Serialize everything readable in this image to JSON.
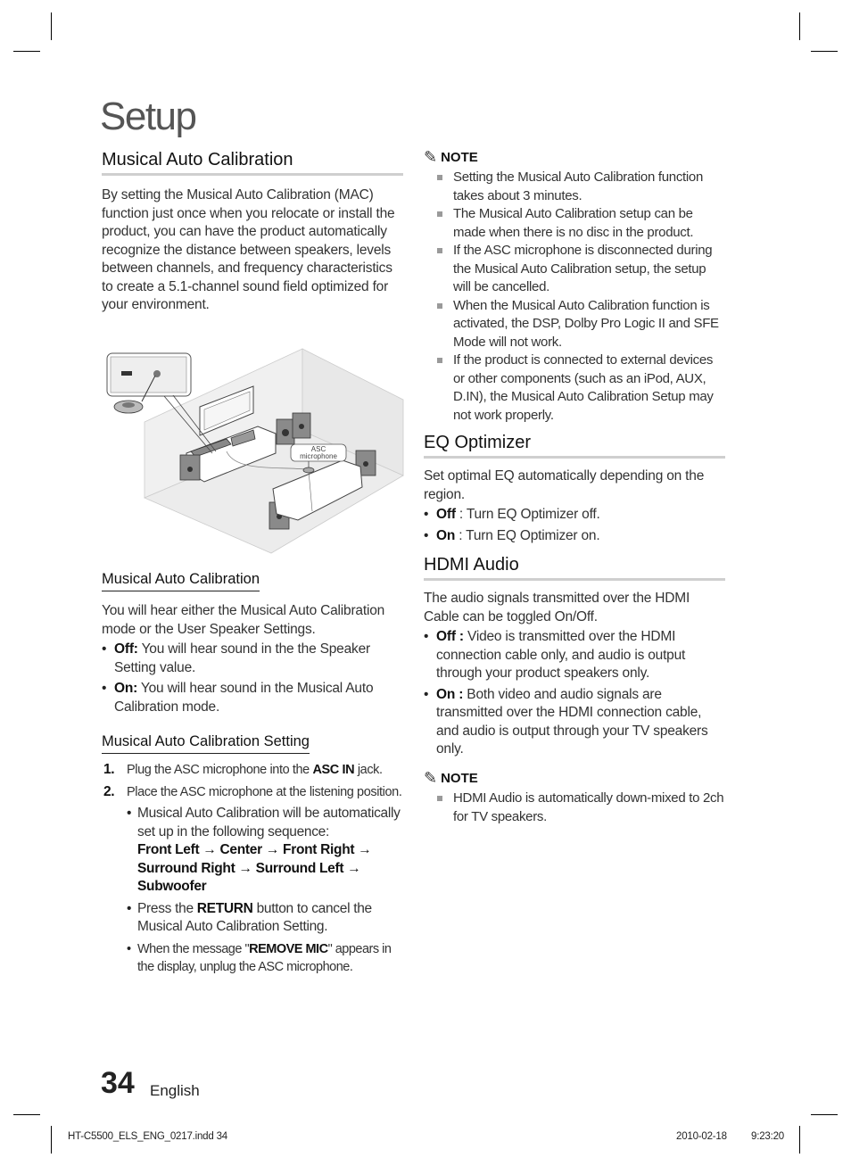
{
  "page": {
    "title": "Setup",
    "page_number": "34",
    "language": "English",
    "slug_file": "HT-C5500_ELS_ENG_0217.indd   34",
    "slug_date": "2010-02-18",
    "slug_time": "9:23:20"
  },
  "left": {
    "mac_heading": "Musical Auto Calibration",
    "mac_intro": "By setting the Musical Auto Calibration (MAC) function just once when you relocate or install the product, you can have the product automatically recognize the distance between speakers, levels between channels, and frequency characteristics to create a 5.1-channel sound field optimized for your environment.",
    "diagram": {
      "mic_label_line1": "ASC",
      "mic_label_line2": "microphone"
    },
    "mode_heading": "Musical Auto Calibration",
    "mode_intro": "You will hear either the Musical Auto Calibration mode or the User Speaker Settings.",
    "mode_items": [
      {
        "label": "Off:",
        "text": " You will hear sound in the the Speaker Setting value."
      },
      {
        "label": "On:",
        "text": " You will hear sound in the Musical Auto Calibration mode."
      }
    ],
    "setting_heading": "Musical Auto Calibration Setting",
    "steps": [
      {
        "num": "1.",
        "pre": "Plug the ASC microphone into the ",
        "bold": "ASC IN",
        "post": " jack."
      },
      {
        "num": "2.",
        "pre": "Place the ASC microphone at the listening position.",
        "bold": "",
        "post": ""
      }
    ],
    "step2_bullets": {
      "seq_intro": "Musical Auto Calibration will be automatically set up in the following sequence:",
      "sequence": "Front Left → Center → Front Right → Surround Right → Surround Left → Subwoofer",
      "return_pre": "Press the ",
      "return_bold": "RETURN",
      "return_post": " button to cancel the Musical Auto Calibration Setting.",
      "remove_pre": "When the message \"",
      "remove_bold": "REMOVE MIC",
      "remove_post": "\" appears in the display, unplug the ASC microphone."
    }
  },
  "right": {
    "note1": {
      "label": "NOTE",
      "icon": "pencil-icon",
      "items": [
        "Setting the Musical Auto Calibration function takes about 3 minutes.",
        "The Musical Auto Calibration setup can be made when there is no disc in the product.",
        "If the ASC microphone is disconnected during the Musical Auto Calibration setup, the setup will be cancelled.",
        "When the Musical Auto Calibration function is activated, the DSP, Dolby Pro Logic II and SFE Mode will not work.",
        "If the product is connected to external devices or other components (such as an iPod, AUX, D.IN), the Musical Auto Calibration Setup may not work properly."
      ]
    },
    "eq": {
      "heading": "EQ Optimizer",
      "intro": "Set optimal EQ automatically depending on the region.",
      "items": [
        {
          "label": "Off",
          "text": " : Turn EQ Optimizer off."
        },
        {
          "label": "On",
          "text": " : Turn EQ Optimizer on."
        }
      ]
    },
    "hdmi": {
      "heading": "HDMI Audio",
      "intro": "The audio signals transmitted over the HDMI Cable can be toggled On/Off.",
      "items": [
        {
          "label": "Off :",
          "text": " Video is transmitted over the HDMI connection cable only, and audio is output through your product speakers only."
        },
        {
          "label": "On :",
          "text": " Both video and audio signals are transmitted over the HDMI connection cable, and audio is output through your TV speakers only."
        }
      ]
    },
    "note2": {
      "label": "NOTE",
      "icon": "pencil-icon",
      "items": [
        "HDMI Audio is automatically down-mixed to 2ch for TV speakers."
      ]
    }
  }
}
